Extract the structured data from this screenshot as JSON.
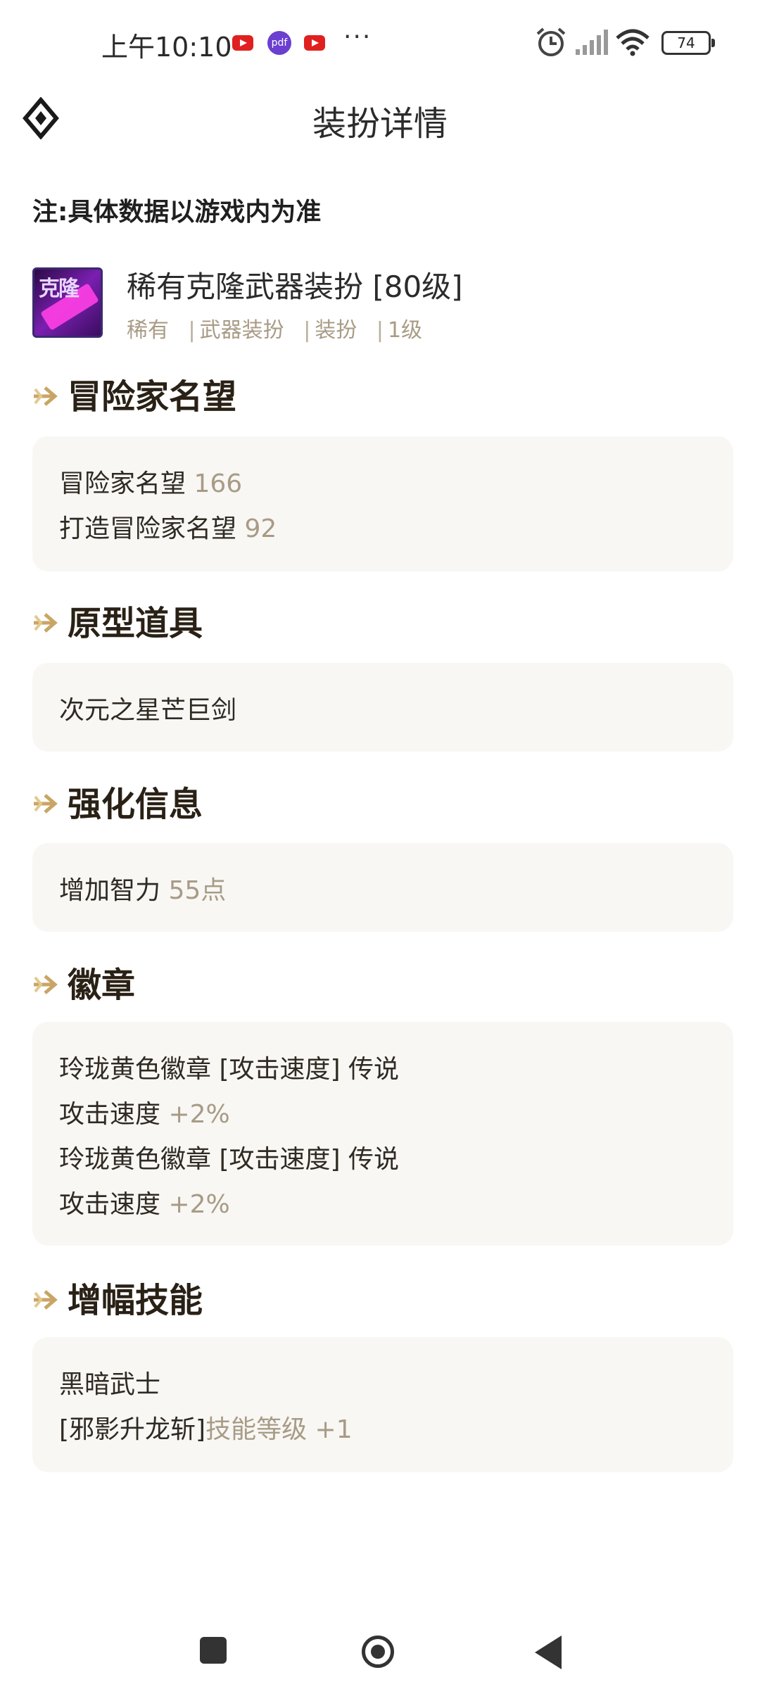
{
  "status_bar": {
    "time": "上午10:10",
    "news_icon_text": "pdf",
    "more": "···",
    "battery": "74"
  },
  "header": {
    "title": "装扮详情"
  },
  "note": "注:具体数据以游戏内为准",
  "item": {
    "icon_text": "克隆",
    "name": "稀有克隆武器装扮 [80级]",
    "tags": [
      "稀有",
      "武器装扮",
      "装扮",
      "1级"
    ]
  },
  "sections": {
    "reputation": {
      "title": "冒险家名望",
      "lines": [
        {
          "label": "冒险家名望",
          "value": "166"
        },
        {
          "label": "打造冒险家名望",
          "value": "92"
        }
      ]
    },
    "prototype": {
      "title": "原型道具",
      "lines": [
        {
          "label": "次元之星芒巨剑",
          "value": ""
        }
      ]
    },
    "enhance": {
      "title": "强化信息",
      "lines": [
        {
          "label": "增加智力",
          "value": "55点"
        }
      ]
    },
    "emblem": {
      "title": "徽章",
      "lines": [
        {
          "label": "玲珑黄色徽章 [攻击速度] 传说",
          "value": ""
        },
        {
          "label": "攻击速度",
          "value": "+2%"
        },
        {
          "label": "玲珑黄色徽章 [攻击速度] 传说",
          "value": ""
        },
        {
          "label": "攻击速度",
          "value": "+2%"
        }
      ]
    },
    "amplify": {
      "title": "增幅技能",
      "lines": [
        {
          "label": "黑暗武士",
          "value": ""
        },
        {
          "label": "[邪影升龙斩]",
          "value": "技能等级 +1"
        }
      ]
    }
  },
  "colors": {
    "accent": "#c9a565",
    "value_text": "#a89b86",
    "card_bg": "#f8f7f4"
  }
}
